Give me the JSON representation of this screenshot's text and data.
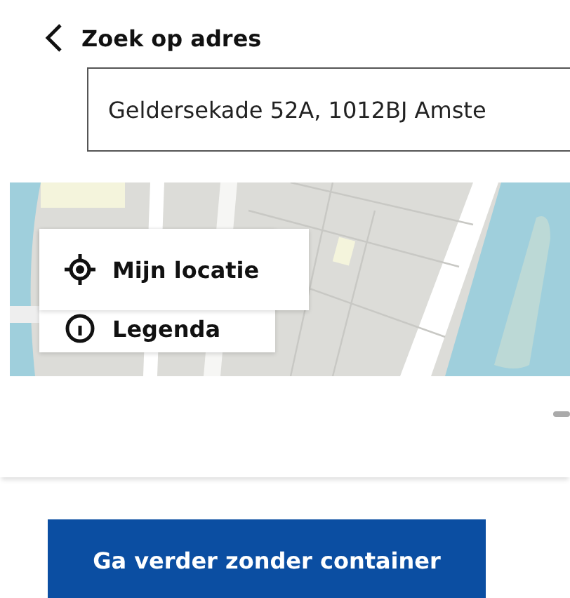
{
  "header": {
    "title": "Zoek op adres"
  },
  "search": {
    "value": "Geldersekade 52A, 1012BJ Amste"
  },
  "map": {
    "menu": [
      {
        "label": "Mijn locatie",
        "kind": "locate"
      },
      {
        "label": "Legenda",
        "kind": "info"
      }
    ]
  },
  "button": {
    "label": "Ga verder zonder container"
  }
}
